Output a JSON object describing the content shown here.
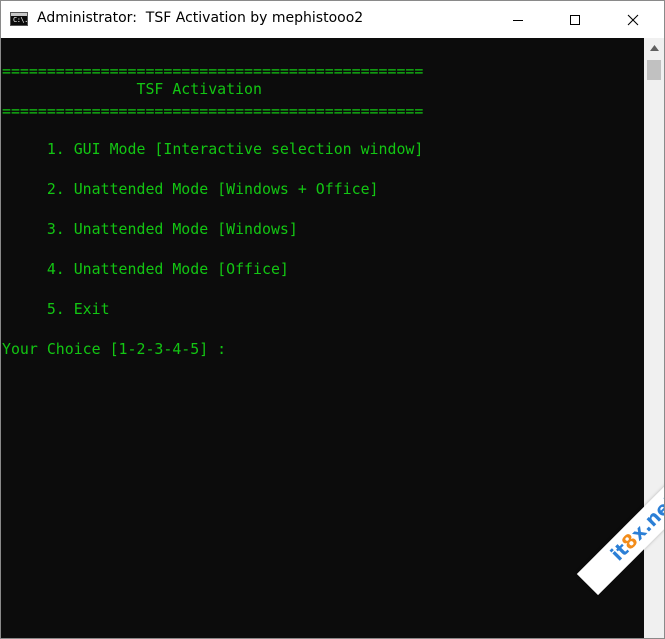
{
  "window": {
    "title": "Administrator:  TSF Activation by mephistooo2",
    "icon": "cmd-icon",
    "icon_text": "C:\\.",
    "controls": {
      "minimize": "minimize-icon",
      "maximize": "maximize-icon",
      "close": "close-icon"
    }
  },
  "console": {
    "separator_top": "===============================================",
    "header": "               TSF Activation",
    "separator_bottom": "===============================================",
    "menu": [
      "     1. GUI Mode [Interactive selection window]",
      "     2. Unattended Mode [Windows + Office]",
      "     3. Unattended Mode [Windows]",
      "     4. Unattended Mode [Office]",
      "     5. Exit"
    ],
    "prompt": "Your Choice [1-2-3-4-5] :",
    "text_color": "#13c613",
    "background": "#0c0c0c"
  },
  "watermark": {
    "prefix": "it",
    "accent": "8",
    "suffix": "x.net"
  }
}
